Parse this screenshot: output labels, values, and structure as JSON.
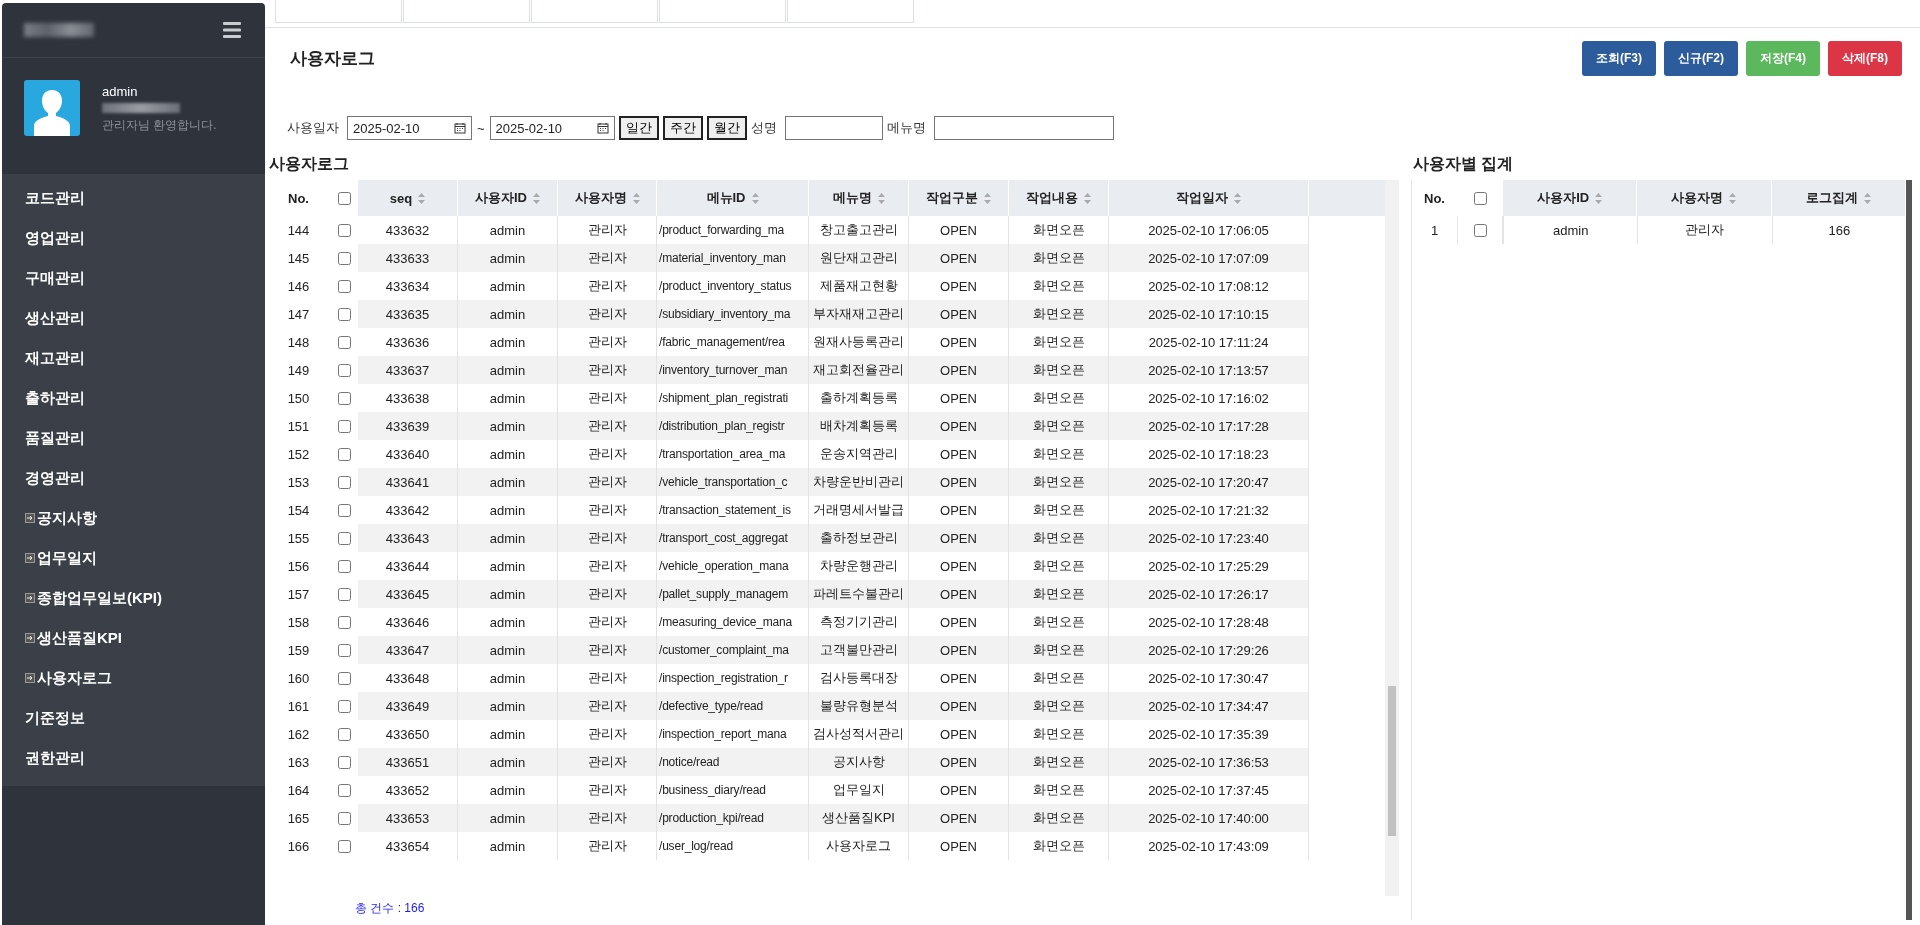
{
  "sidebar": {
    "user": {
      "name": "admin",
      "greeting": "관리자님 환영합니다."
    },
    "items": [
      {
        "label": "코드관리",
        "kind": "group"
      },
      {
        "label": "영업관리",
        "kind": "group"
      },
      {
        "label": "구매관리",
        "kind": "group"
      },
      {
        "label": "생산관리",
        "kind": "group"
      },
      {
        "label": "재고관리",
        "kind": "group"
      },
      {
        "label": "출하관리",
        "kind": "group"
      },
      {
        "label": "품질관리",
        "kind": "group"
      },
      {
        "label": "경영관리",
        "kind": "group"
      },
      {
        "label": "공지사항",
        "kind": "page"
      },
      {
        "label": "업무일지",
        "kind": "page"
      },
      {
        "label": "종합업무일보(KPI)",
        "kind": "page"
      },
      {
        "label": "생산품질KPI",
        "kind": "page"
      },
      {
        "label": "사용자로그",
        "kind": "page"
      },
      {
        "label": "기준정보",
        "kind": "group"
      },
      {
        "label": "권한관리",
        "kind": "group"
      }
    ]
  },
  "page_title": "사용자로그",
  "buttons": [
    {
      "label": "조회(F3)",
      "kind": "primary"
    },
    {
      "label": "신규(F2)",
      "kind": "primary"
    },
    {
      "label": "저장(F4)",
      "kind": "success"
    },
    {
      "label": "삭제(F8)",
      "kind": "danger"
    }
  ],
  "filters": {
    "date_label": "사용일자",
    "date_from": "2025-02-10",
    "separator": "~",
    "date_to": "2025-02-10",
    "periods": [
      "일간",
      "주간",
      "월간"
    ],
    "name_label": "성명",
    "menu_label": "메뉴명"
  },
  "log_table": {
    "title": "사용자로그",
    "select_all_checked": false,
    "columns": [
      "No.",
      "seq",
      "사용자ID",
      "사용자명",
      "메뉴ID",
      "메뉴명",
      "작업구분",
      "작업내용",
      "작업일자"
    ],
    "rows": [
      {
        "no": "144",
        "checked": false,
        "seq": "433632",
        "user_id": "admin",
        "user_name": "관리자",
        "menu_id": "/product_forwarding_ma",
        "menu_name": "창고출고관리",
        "action": "OPEN",
        "detail": "화면오픈",
        "date": "2025-02-10 17:06:05"
      },
      {
        "no": "145",
        "checked": false,
        "seq": "433633",
        "user_id": "admin",
        "user_name": "관리자",
        "menu_id": "/material_inventory_man",
        "menu_name": "원단재고관리",
        "action": "OPEN",
        "detail": "화면오픈",
        "date": "2025-02-10 17:07:09"
      },
      {
        "no": "146",
        "checked": false,
        "seq": "433634",
        "user_id": "admin",
        "user_name": "관리자",
        "menu_id": "/product_inventory_status",
        "menu_name": "제품재고현황",
        "action": "OPEN",
        "detail": "화면오픈",
        "date": "2025-02-10 17:08:12"
      },
      {
        "no": "147",
        "checked": false,
        "seq": "433635",
        "user_id": "admin",
        "user_name": "관리자",
        "menu_id": "/subsidiary_inventory_ma",
        "menu_name": "부자재재고관리",
        "action": "OPEN",
        "detail": "화면오픈",
        "date": "2025-02-10 17:10:15"
      },
      {
        "no": "148",
        "checked": false,
        "seq": "433636",
        "user_id": "admin",
        "user_name": "관리자",
        "menu_id": "/fabric_management/rea",
        "menu_name": "원재사등록관리",
        "action": "OPEN",
        "detail": "화면오픈",
        "date": "2025-02-10 17:11:24"
      },
      {
        "no": "149",
        "checked": false,
        "seq": "433637",
        "user_id": "admin",
        "user_name": "관리자",
        "menu_id": "/inventory_turnover_man",
        "menu_name": "재고회전율관리",
        "action": "OPEN",
        "detail": "화면오픈",
        "date": "2025-02-10 17:13:57"
      },
      {
        "no": "150",
        "checked": false,
        "seq": "433638",
        "user_id": "admin",
        "user_name": "관리자",
        "menu_id": "/shipment_plan_registrati",
        "menu_name": "출하계획등록",
        "action": "OPEN",
        "detail": "화면오픈",
        "date": "2025-02-10 17:16:02"
      },
      {
        "no": "151",
        "checked": false,
        "seq": "433639",
        "user_id": "admin",
        "user_name": "관리자",
        "menu_id": "/distribution_plan_registr",
        "menu_name": "배차계획등록",
        "action": "OPEN",
        "detail": "화면오픈",
        "date": "2025-02-10 17:17:28"
      },
      {
        "no": "152",
        "checked": false,
        "seq": "433640",
        "user_id": "admin",
        "user_name": "관리자",
        "menu_id": "/transportation_area_ma",
        "menu_name": "운송지역관리",
        "action": "OPEN",
        "detail": "화면오픈",
        "date": "2025-02-10 17:18:23"
      },
      {
        "no": "153",
        "checked": false,
        "seq": "433641",
        "user_id": "admin",
        "user_name": "관리자",
        "menu_id": "/vehicle_transportation_c",
        "menu_name": "차량운반비관리",
        "action": "OPEN",
        "detail": "화면오픈",
        "date": "2025-02-10 17:20:47"
      },
      {
        "no": "154",
        "checked": false,
        "seq": "433642",
        "user_id": "admin",
        "user_name": "관리자",
        "menu_id": "/transaction_statement_is",
        "menu_name": "거래명세서발급",
        "action": "OPEN",
        "detail": "화면오픈",
        "date": "2025-02-10 17:21:32"
      },
      {
        "no": "155",
        "checked": false,
        "seq": "433643",
        "user_id": "admin",
        "user_name": "관리자",
        "menu_id": "/transport_cost_aggregat",
        "menu_name": "출하정보관리",
        "action": "OPEN",
        "detail": "화면오픈",
        "date": "2025-02-10 17:23:40"
      },
      {
        "no": "156",
        "checked": false,
        "seq": "433644",
        "user_id": "admin",
        "user_name": "관리자",
        "menu_id": "/vehicle_operation_mana",
        "menu_name": "차량운행관리",
        "action": "OPEN",
        "detail": "화면오픈",
        "date": "2025-02-10 17:25:29"
      },
      {
        "no": "157",
        "checked": false,
        "seq": "433645",
        "user_id": "admin",
        "user_name": "관리자",
        "menu_id": "/pallet_supply_managem",
        "menu_name": "파레트수불관리",
        "action": "OPEN",
        "detail": "화면오픈",
        "date": "2025-02-10 17:26:17"
      },
      {
        "no": "158",
        "checked": false,
        "seq": "433646",
        "user_id": "admin",
        "user_name": "관리자",
        "menu_id": "/measuring_device_mana",
        "menu_name": "측정기기관리",
        "action": "OPEN",
        "detail": "화면오픈",
        "date": "2025-02-10 17:28:48"
      },
      {
        "no": "159",
        "checked": false,
        "seq": "433647",
        "user_id": "admin",
        "user_name": "관리자",
        "menu_id": "/customer_complaint_ma",
        "menu_name": "고객불만관리",
        "action": "OPEN",
        "detail": "화면오픈",
        "date": "2025-02-10 17:29:26"
      },
      {
        "no": "160",
        "checked": false,
        "seq": "433648",
        "user_id": "admin",
        "user_name": "관리자",
        "menu_id": "/inspection_registration_r",
        "menu_name": "검사등록대장",
        "action": "OPEN",
        "detail": "화면오픈",
        "date": "2025-02-10 17:30:47"
      },
      {
        "no": "161",
        "checked": false,
        "seq": "433649",
        "user_id": "admin",
        "user_name": "관리자",
        "menu_id": "/defective_type/read",
        "menu_name": "불량유형분석",
        "action": "OPEN",
        "detail": "화면오픈",
        "date": "2025-02-10 17:34:47"
      },
      {
        "no": "162",
        "checked": false,
        "seq": "433650",
        "user_id": "admin",
        "user_name": "관리자",
        "menu_id": "/inspection_report_mana",
        "menu_name": "검사성적서관리",
        "action": "OPEN",
        "detail": "화면오픈",
        "date": "2025-02-10 17:35:39"
      },
      {
        "no": "163",
        "checked": false,
        "seq": "433651",
        "user_id": "admin",
        "user_name": "관리자",
        "menu_id": "/notice/read",
        "menu_name": "공지사항",
        "action": "OPEN",
        "detail": "화면오픈",
        "date": "2025-02-10 17:36:53"
      },
      {
        "no": "164",
        "checked": false,
        "seq": "433652",
        "user_id": "admin",
        "user_name": "관리자",
        "menu_id": "/business_diary/read",
        "menu_name": "업무일지",
        "action": "OPEN",
        "detail": "화면오픈",
        "date": "2025-02-10 17:37:45"
      },
      {
        "no": "165",
        "checked": false,
        "seq": "433653",
        "user_id": "admin",
        "user_name": "관리자",
        "menu_id": "/production_kpi/read",
        "menu_name": "생산품질KPI",
        "action": "OPEN",
        "detail": "화면오픈",
        "date": "2025-02-10 17:40:00"
      },
      {
        "no": "166",
        "checked": false,
        "seq": "433654",
        "user_id": "admin",
        "user_name": "관리자",
        "menu_id": "/user_log/read",
        "menu_name": "사용자로그",
        "action": "OPEN",
        "detail": "화면오픈",
        "date": "2025-02-10 17:43:09"
      }
    ],
    "total": "총 건수 : 166"
  },
  "summary_table": {
    "title": "사용자별 집계",
    "select_all_checked": false,
    "columns": [
      "No.",
      "사용자ID",
      "사용자명",
      "로그집계"
    ],
    "rows": [
      {
        "no": "1",
        "checked": false,
        "user_id": "admin",
        "user_name": "관리자",
        "count": "166"
      }
    ]
  }
}
